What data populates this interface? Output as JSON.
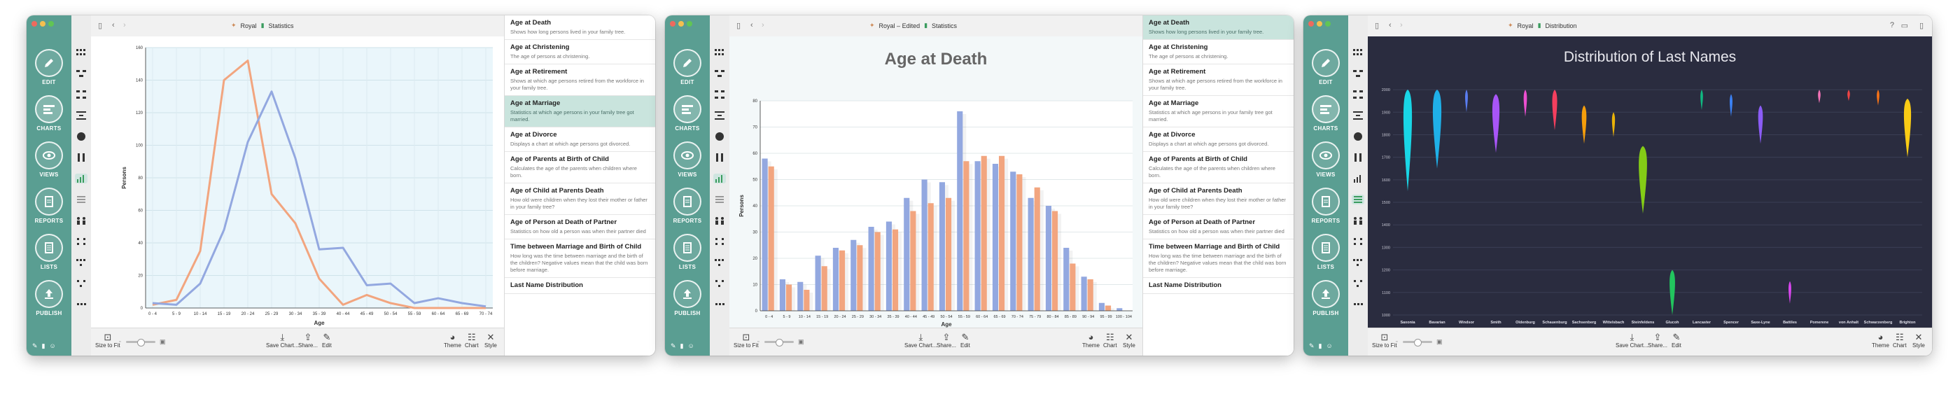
{
  "nav": [
    {
      "label": "EDIT",
      "icon": "pencil-icon"
    },
    {
      "label": "CHARTS",
      "icon": "charts-icon"
    },
    {
      "label": "VIEWS",
      "icon": "eye-icon"
    },
    {
      "label": "REPORTS",
      "icon": "document-icon"
    },
    {
      "label": "LISTS",
      "icon": "list-icon"
    },
    {
      "label": "PUBLISH",
      "icon": "upload-icon"
    }
  ],
  "toolbar_buttons": [
    "Size to Fit",
    "Save Chart...",
    "Share...",
    "Edit",
    "Theme",
    "Chart",
    "Style"
  ],
  "chart_list": [
    {
      "title": "Age at Death",
      "desc": "Shows how long persons lived in your family tree."
    },
    {
      "title": "Age at Christening",
      "desc": "The age of persons at christening."
    },
    {
      "title": "Age at Retirement",
      "desc": "Shows at which age persons retired from the workforce in your family tree."
    },
    {
      "title": "Age at Marriage",
      "desc": "Statistics at which age persons in your family tree got married."
    },
    {
      "title": "Age at Divorce",
      "desc": "Displays a chart at which age persons got divorced."
    },
    {
      "title": "Age of Parents at Birth of Child",
      "desc": "Calculates the age of the parents when children where born."
    },
    {
      "title": "Age of Child at Parents Death",
      "desc": "How old were children when they lost their mother or father in your family tree?"
    },
    {
      "title": "Age of Person at Death of Partner",
      "desc": "Statistics on how old a person was when their partner died"
    },
    {
      "title": "Time between Marriage and Birth of Child",
      "desc": "How long was the time between marriage and the birth of the children? Negative values mean that the child was born before marriage."
    },
    {
      "title": "Last Name Distribution",
      "desc": ""
    }
  ],
  "windows": [
    {
      "crumb1": "Royal",
      "crumb2": "Statistics",
      "selected_index": 3
    },
    {
      "crumb1": "Royal – Edited",
      "crumb2": "Statistics",
      "selected_index": 0
    },
    {
      "crumb1": "Royal",
      "crumb2": "Distribution",
      "selected_index": null
    }
  ],
  "chart_data": [
    {
      "type": "line",
      "title": "",
      "xlabel": "Age",
      "ylabel": "Persons",
      "categories": [
        "0 - 4",
        "5 - 9",
        "10 - 14",
        "15 - 19",
        "20 - 24",
        "25 - 29",
        "30 - 34",
        "35 - 39",
        "40 - 44",
        "45 - 49",
        "50 - 54",
        "55 - 59",
        "60 - 64",
        "65 - 69",
        "70 - 74"
      ],
      "ylim": [
        0,
        160
      ],
      "yticks": [
        0,
        20,
        40,
        60,
        80,
        100,
        120,
        140,
        160
      ],
      "series": [
        {
          "color": "#f2a57f",
          "values": [
            2,
            5,
            35,
            140,
            152,
            70,
            52,
            18,
            2,
            8,
            3,
            0,
            0,
            0,
            0
          ]
        },
        {
          "color": "#93a8e0",
          "values": [
            3,
            2,
            15,
            48,
            102,
            133,
            92,
            36,
            37,
            14,
            15,
            3,
            6,
            3,
            1
          ]
        }
      ],
      "grid": true,
      "legend": "none"
    },
    {
      "type": "bar",
      "title": "Age at Death",
      "xlabel": "Age",
      "ylabel": "Persons",
      "categories": [
        "0 - 4",
        "5 - 9",
        "10 - 14",
        "15 - 19",
        "20 - 24",
        "25 - 29",
        "30 - 34",
        "35 - 39",
        "40 - 44",
        "45 - 49",
        "50 - 54",
        "55 - 59",
        "60 - 64",
        "65 - 69",
        "70 - 74",
        "75 - 79",
        "80 - 84",
        "85 - 89",
        "90 - 94",
        "95 - 99",
        "100 - 104"
      ],
      "ylim": [
        0,
        80
      ],
      "yticks": [
        0,
        10,
        20,
        30,
        40,
        50,
        60,
        70,
        80
      ],
      "series": [
        {
          "color": "#93a8e0",
          "values": [
            58,
            12,
            11,
            21,
            24,
            27,
            32,
            34,
            43,
            50,
            49,
            76,
            57,
            56,
            53,
            43,
            40,
            24,
            13,
            3,
            1
          ]
        },
        {
          "color": "#f2a57f",
          "values": [
            55,
            10,
            8,
            17,
            23,
            25,
            30,
            31,
            38,
            41,
            43,
            57,
            59,
            59,
            52,
            47,
            38,
            18,
            12,
            2,
            0
          ]
        }
      ],
      "grid": true,
      "legend": "none"
    },
    {
      "type": "violin",
      "title": "Distribution of Last Names",
      "xlabel": "",
      "ylabel": "",
      "categories": [
        "Saxonia",
        "Bavarian",
        "Windsor",
        "Smith",
        "Oldenburg",
        "Schauenburg",
        "Sachsenberg",
        "Wittelsbach",
        "Steinfeldens",
        "Glucoh",
        "Lancaster",
        "Spencer",
        "Saxe-Lyne",
        "Battiles",
        "Pomerene",
        "von Anhalt",
        "Schwarzenberg",
        "Brighton"
      ],
      "ylim": [
        1000,
        2050
      ],
      "yticks": [
        1000,
        1100,
        1200,
        1300,
        1400,
        1500,
        1600,
        1700,
        1800,
        1900,
        2000
      ],
      "series": [
        {
          "color": "#19d6e6",
          "range": [
            1550,
            2000
          ]
        },
        {
          "color": "#1fb0e8",
          "range": [
            1650,
            2000
          ]
        },
        {
          "color": "#5a7df0",
          "range": [
            1900,
            2000
          ]
        },
        {
          "color": "#a855f7",
          "range": [
            1720,
            1980
          ]
        },
        {
          "color": "#ec4fd0",
          "range": [
            1880,
            2000
          ]
        },
        {
          "color": "#f43f5e",
          "range": [
            1820,
            2000
          ]
        },
        {
          "color": "#f59e0b",
          "range": [
            1760,
            1930
          ]
        },
        {
          "color": "#eab308",
          "range": [
            1790,
            1900
          ]
        },
        {
          "color": "#84cc16",
          "range": [
            1450,
            1750
          ]
        },
        {
          "color": "#22c55e",
          "range": [
            1000,
            1200
          ]
        },
        {
          "color": "#10b981",
          "range": [
            1910,
            2000
          ]
        },
        {
          "color": "#3b82f6",
          "range": [
            1880,
            1980
          ]
        },
        {
          "color": "#8b5cf6",
          "range": [
            1760,
            1930
          ]
        },
        {
          "color": "#d946ef",
          "range": [
            1050,
            1150
          ]
        },
        {
          "color": "#f472b6",
          "range": [
            1940,
            2000
          ]
        },
        {
          "color": "#ef4444",
          "range": [
            1950,
            2000
          ]
        },
        {
          "color": "#f97316",
          "range": [
            1930,
            2000
          ]
        },
        {
          "color": "#facc15",
          "range": [
            1700,
            1960
          ]
        }
      ],
      "grid": true,
      "legend": "none"
    }
  ]
}
